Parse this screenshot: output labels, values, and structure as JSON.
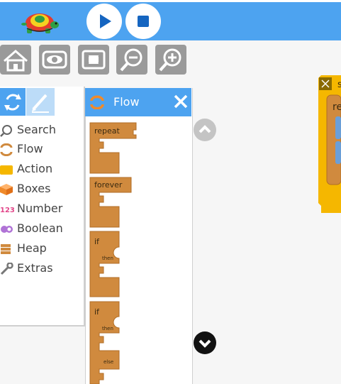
{
  "toolbar": {
    "run_button": "play-icon",
    "stop_button": "stop-icon"
  },
  "view_buttons": [
    "home-icon",
    "eye-icon",
    "fit-icon",
    "zoom-out-icon",
    "zoom-in-icon"
  ],
  "categories": [
    {
      "label": "Search",
      "icon": "search-icon"
    },
    {
      "label": "Flow",
      "icon": "flow-icon"
    },
    {
      "label": "Action",
      "icon": "action-icon"
    },
    {
      "label": "Boxes",
      "icon": "box-icon"
    },
    {
      "label": "Number",
      "icon": "number-icon"
    },
    {
      "label": "Boolean",
      "icon": "boolean-icon"
    },
    {
      "label": "Heap",
      "icon": "heap-icon"
    },
    {
      "label": "Extras",
      "icon": "wrench-icon"
    }
  ],
  "flyout": {
    "title": "Flow",
    "blocks": {
      "repeat": "repeat",
      "forever": "forever",
      "if1": "if",
      "if1_then": "then",
      "if2": "if",
      "if2_then": "then",
      "if2_else": "else"
    }
  },
  "workspace": {
    "block_label_partial": "re",
    "block_top_partial": "s"
  },
  "colors": {
    "accent": "#4da3f0",
    "flow_block": "#d08a3e",
    "action_block": "#f5b700",
    "gray_button": "#9a9a9a"
  }
}
